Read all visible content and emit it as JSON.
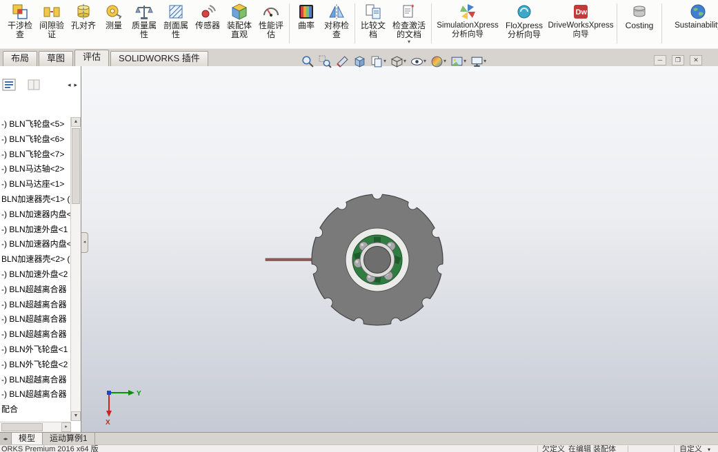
{
  "ribbon": {
    "buttons": [
      {
        "label": "干涉检查",
        "icon": "interference-detection-icon",
        "has_dropdown": false
      },
      {
        "label": "间隙验证",
        "icon": "clearance-verification-icon",
        "has_dropdown": false
      },
      {
        "label": "孔对齐",
        "icon": "hole-alignment-icon",
        "has_dropdown": false
      },
      {
        "label": "测量",
        "icon": "measure-icon",
        "has_dropdown": false
      },
      {
        "label": "质量属性",
        "icon": "mass-properties-icon",
        "has_dropdown": false
      },
      {
        "label": "剖面属性",
        "icon": "section-properties-icon",
        "has_dropdown": false
      },
      {
        "label": "传感器",
        "icon": "sensor-icon",
        "has_dropdown": false
      },
      {
        "label": "装配体直观",
        "icon": "assembly-visualization-icon",
        "has_dropdown": false
      },
      {
        "label": "性能评估",
        "icon": "performance-evaluation-icon",
        "has_dropdown": false
      },
      {
        "label": "曲率",
        "icon": "curvature-icon",
        "has_dropdown": false
      },
      {
        "label": "对称检查",
        "icon": "symmetry-check-icon",
        "has_dropdown": false
      },
      {
        "label": "比较文档",
        "icon": "compare-documents-icon",
        "has_dropdown": false
      },
      {
        "label": "检查激活的文档",
        "icon": "check-active-document-icon",
        "has_dropdown": true
      },
      {
        "label": "SimulationXpress 分析向导",
        "icon": "simulationxpress-icon",
        "has_dropdown": false
      },
      {
        "label": "FloXpress 分析向导",
        "icon": "floxpress-icon",
        "has_dropdown": false
      },
      {
        "label": "DriveWorksXpress 向导",
        "icon": "driveworksxpress-icon",
        "has_dropdown": false
      },
      {
        "label": "Costing",
        "icon": "costing-icon",
        "has_dropdown": false
      },
      {
        "label": "Sustainability",
        "icon": "sustainability-icon",
        "has_dropdown": false
      }
    ]
  },
  "tabs": {
    "items": [
      {
        "label": "布局",
        "active": false
      },
      {
        "label": "草图",
        "active": false
      },
      {
        "label": "评估",
        "active": true
      },
      {
        "label": "SOLIDWORKS 插件",
        "active": false
      }
    ]
  },
  "view_toolbar": {
    "icons": [
      "zoom-fit-icon",
      "zoom-area-icon",
      "section-view-icon",
      "view-orientation-icon",
      "display-pages-icon",
      "display-style-icon",
      "hide-show-items-icon",
      "edit-appearance-icon",
      "apply-scene-icon",
      "view-settings-icon"
    ]
  },
  "window_controls": {
    "icons": [
      "minimize-window-icon",
      "restore-window-icon",
      "close-window-icon"
    ]
  },
  "tree": {
    "items": [
      "-) BLN飞轮盘<5>",
      "-) BLN飞轮盘<6>",
      "-) BLN飞轮盘<7>",
      "-) BLN马达轴<2>",
      "-) BLN马达座<1>",
      "BLN加速器壳<1> (",
      "-) BLN加速器内盘<",
      "-) BLN加速外盘<1",
      "-) BLN加速器内盘<",
      "BLN加速器壳<2> (",
      "-) BLN加速外盘<2",
      "-) BLN超越离合器",
      "-) BLN超越离合器",
      "-) BLN超越离合器",
      "-) BLN超越离合器",
      "-) BLN外飞轮盘<1",
      "-) BLN外飞轮盘<2",
      "-) BLN超越离合器",
      "-) BLN超越离合器",
      "配合"
    ]
  },
  "viewport": {
    "triad": {
      "x_label": "X",
      "y_label": "Y"
    }
  },
  "bottom_tabs": {
    "items": [
      {
        "label": "模型",
        "active": true
      },
      {
        "label": "运动算例1",
        "active": false
      }
    ]
  },
  "status_bar": {
    "version": "ORKS Premium 2016 x64 版",
    "state": "欠定义",
    "edit_mode": "在编辑 装配体",
    "custom": "自定义"
  },
  "colors": {
    "viewport_top": "#f6f7f9",
    "viewport_bottom": "#c6cad4",
    "wheel_gray": "#7a7a7a",
    "bearing_green": "#2f7d40",
    "shaft_red": "#915a5a",
    "triad_x": "#cc2222",
    "triad_y": "#0a8f0a",
    "tab_bar": "#d7d4cf"
  }
}
